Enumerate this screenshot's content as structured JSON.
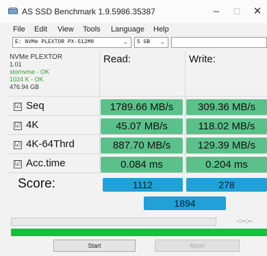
{
  "window": {
    "title": "AS SSD Benchmark 1.9.5986.35387",
    "min_glyph": "–",
    "max_glyph": "☐",
    "close_glyph": "✕"
  },
  "menu": [
    "File",
    "Edit",
    "View",
    "Tools",
    "Language",
    "Help"
  ],
  "drive_select": {
    "value": "E: NVMe PLEXTOR PX-512M8"
  },
  "size_select": {
    "value": "5 GB"
  },
  "drive_info": {
    "name": "NVMe PLEXTOR",
    "firmware": "1.01",
    "driver": "stornvme - OK",
    "alignment": "1024 K - OK",
    "capacity": "476.94 GB"
  },
  "headers": {
    "read": "Read:",
    "write": "Write:"
  },
  "rows": [
    {
      "label": "Seq",
      "read": "1789.66 MB/s",
      "write": "309.36 MB/s"
    },
    {
      "label": "4K",
      "read": "45.07 MB/s",
      "write": "118.02 MB/s"
    },
    {
      "label": "4K-64Thrd",
      "read": "887.70 MB/s",
      "write": "129.39 MB/s"
    },
    {
      "label": "Acc.time",
      "read": "0.084 ms",
      "write": "0.204 ms"
    }
  ],
  "check_glyph": "☑",
  "score": {
    "label": "Score:",
    "read": "1112",
    "write": "278",
    "total": "1894"
  },
  "progress": {
    "time": "-:--:--",
    "fraction": 0
  },
  "buttons": {
    "start": "Start",
    "abort": "Abort"
  },
  "colors": {
    "result_green": "#5cc08a",
    "score_blue": "#22a0d8",
    "status_green": "#11c13f"
  }
}
